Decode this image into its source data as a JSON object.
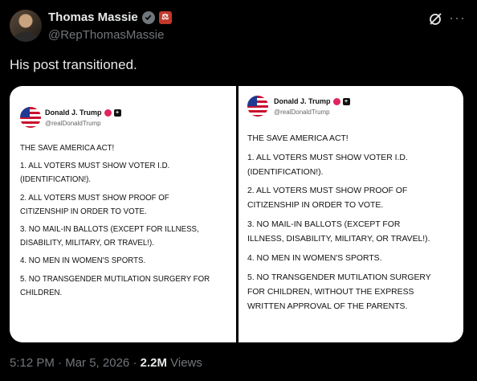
{
  "author": {
    "display_name": "Thomas Massie",
    "handle": "@RepThomasMassie"
  },
  "post": {
    "text": "His post transitioned."
  },
  "embedded_left": {
    "name": "Donald J. Trump",
    "handle": "@realDonaldTrump",
    "lines": [
      "THE SAVE AMERICA ACT!",
      "",
      "1. ALL VOTERS MUST SHOW VOTER I.D.",
      "(IDENTIFICATION!).",
      "",
      "2. ALL VOTERS MUST SHOW PROOF OF",
      "CITIZENSHIP IN ORDER TO VOTE.",
      "",
      "3. NO MAIL-IN BALLOTS (EXCEPT FOR ILLNESS,",
      "DISABILITY, MILITARY, OR TRAVEL!).",
      "",
      "4. NO MEN IN WOMEN'S SPORTS.",
      "",
      "5. NO TRANSGENDER MUTILATION SURGERY FOR",
      "CHILDREN."
    ]
  },
  "embedded_right": {
    "name": "Donald J. Trump",
    "handle": "@realDonaldTrump",
    "lines": [
      "THE SAVE AMERICA ACT!",
      "",
      "1. ALL VOTERS MUST SHOW VOTER I.D.",
      "(IDENTIFICATION!).",
      "",
      "2. ALL VOTERS MUST SHOW PROOF OF",
      "CITIZENSHIP IN ORDER TO VOTE.",
      "",
      "3. NO MAIL-IN BALLOTS (EXCEPT FOR",
      "ILLNESS, DISABILITY, MILITARY, OR TRAVEL!).",
      "",
      "4. NO MEN IN WOMEN'S SPORTS.",
      "",
      "5. NO TRANSGENDER MUTILATION SURGERY",
      "FOR CHILDREN, WITHOUT THE EXPRESS",
      "WRITTEN APPROVAL OF THE PARENTS."
    ]
  },
  "meta": {
    "time": "5:12 PM",
    "date": "Mar 5, 2026",
    "views_count": "2.2M",
    "views_label": "Views"
  },
  "icons": {
    "verified": "verified-badge-icon",
    "affiliation": "affiliation-badge-icon",
    "grok": "grok-icon",
    "more": "more-icon"
  },
  "colors": {
    "background": "#000000",
    "secondary_text": "#71767b",
    "verified_gray": "#71767b",
    "affiliation_red": "#c0392b"
  }
}
